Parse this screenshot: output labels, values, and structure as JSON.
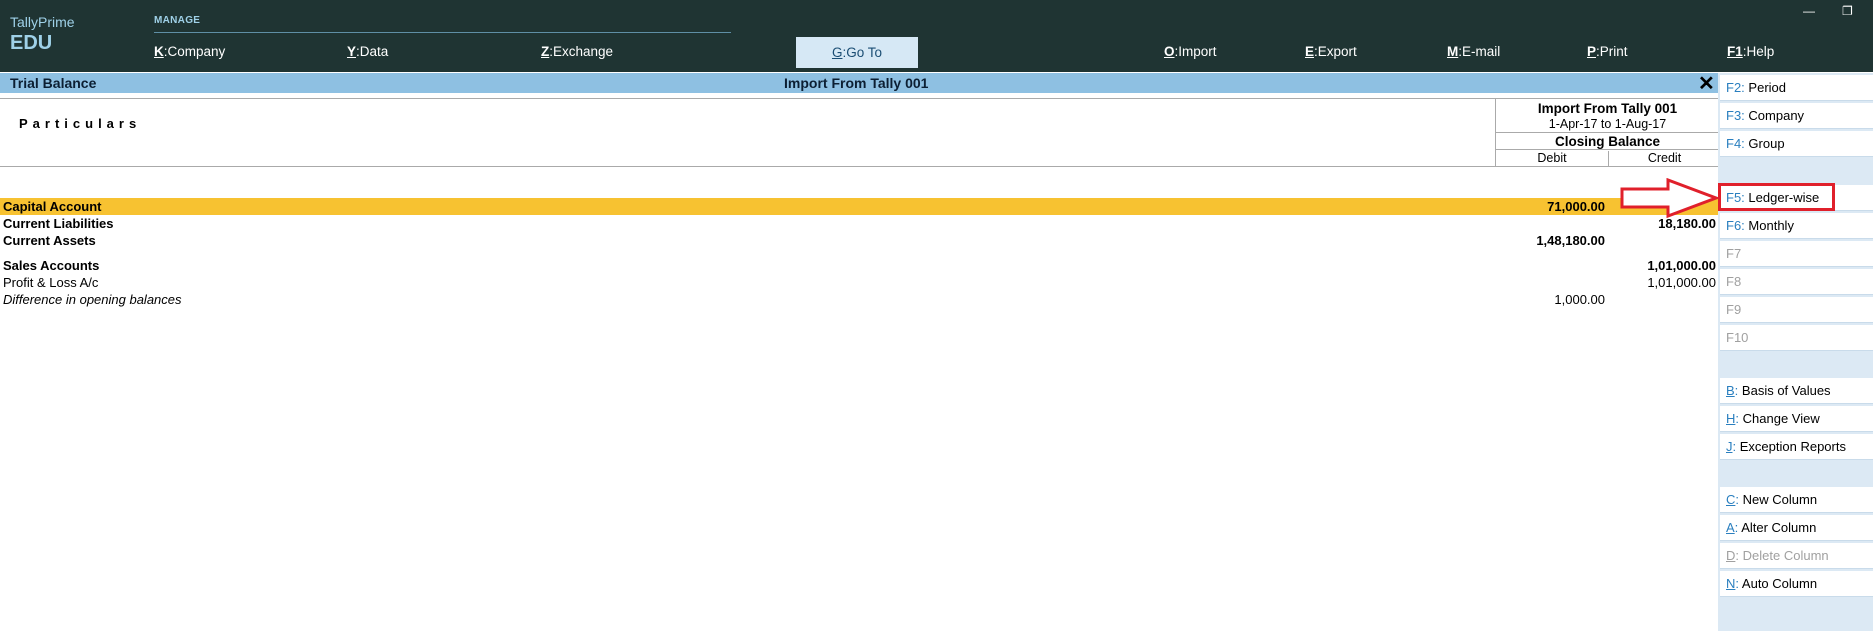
{
  "app": {
    "brand_top": "TallyPrime",
    "brand_bottom": "EDU"
  },
  "topmenu": {
    "section_label": "MANAGE",
    "items": [
      {
        "key": "K",
        "label": "Company"
      },
      {
        "key": "Y",
        "label": "Data"
      },
      {
        "key": "Z",
        "label": "Exchange"
      },
      {
        "key": "G",
        "label": "Go To"
      },
      {
        "key": "O",
        "label": "Import"
      },
      {
        "key": "E",
        "label": "Export"
      },
      {
        "key": "M",
        "label": "E-mail"
      },
      {
        "key": "P",
        "label": "Print"
      },
      {
        "key": "F1",
        "label": "Help"
      }
    ]
  },
  "window_controls": {
    "minimize": "—",
    "restore": "❐"
  },
  "report": {
    "title": "Trial Balance",
    "company_title": "Import From Tally 001",
    "close": "✕",
    "particulars_label": "Particulars",
    "column": {
      "company": "Import From Tally 001",
      "period": "1-Apr-17 to 1-Aug-17",
      "balance_type": "Closing Balance",
      "debit": "Debit",
      "credit": "Credit"
    },
    "rows": [
      {
        "name": "Capital Account",
        "debit": "71,000.00",
        "credit": ""
      },
      {
        "name": "Current Liabilities",
        "debit": "",
        "credit": "18,180.00"
      },
      {
        "name": "Current Assets",
        "debit": "1,48,180.00",
        "credit": ""
      },
      {
        "name": "Sales Accounts",
        "debit": "",
        "credit": "1,01,000.00"
      },
      {
        "name": "Profit & Loss A/c",
        "debit": "",
        "credit": "1,01,000.00"
      },
      {
        "name": "Difference in opening balances",
        "debit": "1,000.00",
        "credit": ""
      }
    ]
  },
  "side_buttons": [
    {
      "key": "F2",
      "label": "Period"
    },
    {
      "key": "F3",
      "label": "Company"
    },
    {
      "key": "F4",
      "label": "Group"
    },
    {
      "key": "F5",
      "label": "Ledger-wise"
    },
    {
      "key": "F6",
      "label": "Monthly"
    },
    {
      "key": "F7",
      "label": ""
    },
    {
      "key": "F8",
      "label": ""
    },
    {
      "key": "F9",
      "label": ""
    },
    {
      "key": "F10",
      "label": ""
    },
    {
      "key": "B",
      "label": "Basis of Values"
    },
    {
      "key": "H",
      "label": "Change View"
    },
    {
      "key": "J",
      "label": "Exception Reports"
    },
    {
      "key": "C",
      "label": "New Column"
    },
    {
      "key": "A",
      "label": "Alter Column"
    },
    {
      "key": "D",
      "label": "Delete Column"
    },
    {
      "key": "N",
      "label": "Auto Column"
    }
  ],
  "colors": {
    "topbar": "#1f3433",
    "accent": "#8ec0e2",
    "selected_row": "#f7c231",
    "highlight": "#e0202b"
  }
}
